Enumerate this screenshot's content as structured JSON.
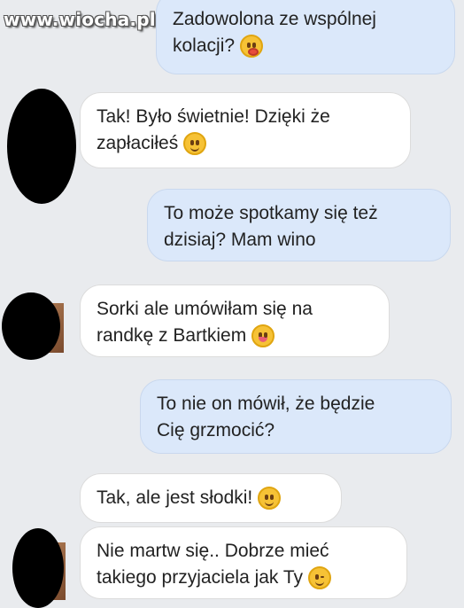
{
  "watermark": "www.wiocha.pl",
  "messages": [
    {
      "from": "me",
      "lines": [
        "Zadowolona ze wspólnej",
        "kolacji?"
      ],
      "emoji": "blushing-face-icon"
    },
    {
      "from": "them",
      "lines": [
        "Tak! Było świetnie! Dzięki że",
        "zapłaciłeś"
      ],
      "emoji": "smiling-face-icon"
    },
    {
      "from": "me",
      "lines": [
        "To może spotkamy się też",
        "dzisiaj? Mam wino"
      ]
    },
    {
      "from": "them",
      "lines": [
        "Sorki ale umówiłam się na",
        "randkę z Bartkiem"
      ],
      "emoji": "tongue-face-icon"
    },
    {
      "from": "me",
      "lines": [
        "To nie on mówił, że będzie",
        "Cię grzmocić?"
      ]
    },
    {
      "from": "them",
      "lines": [
        "Tak, ale jest słodki!"
      ],
      "emoji": "smiling-face-icon"
    },
    {
      "from": "them",
      "lines": [
        "Nie martw się.. Dobrze mieć",
        "takiego przyjaciela jak Ty"
      ],
      "emoji": "winking-face-icon"
    }
  ],
  "colors": {
    "background": "#e9ebee",
    "outgoing": "#dbe8fa",
    "incoming": "#ffffff"
  }
}
